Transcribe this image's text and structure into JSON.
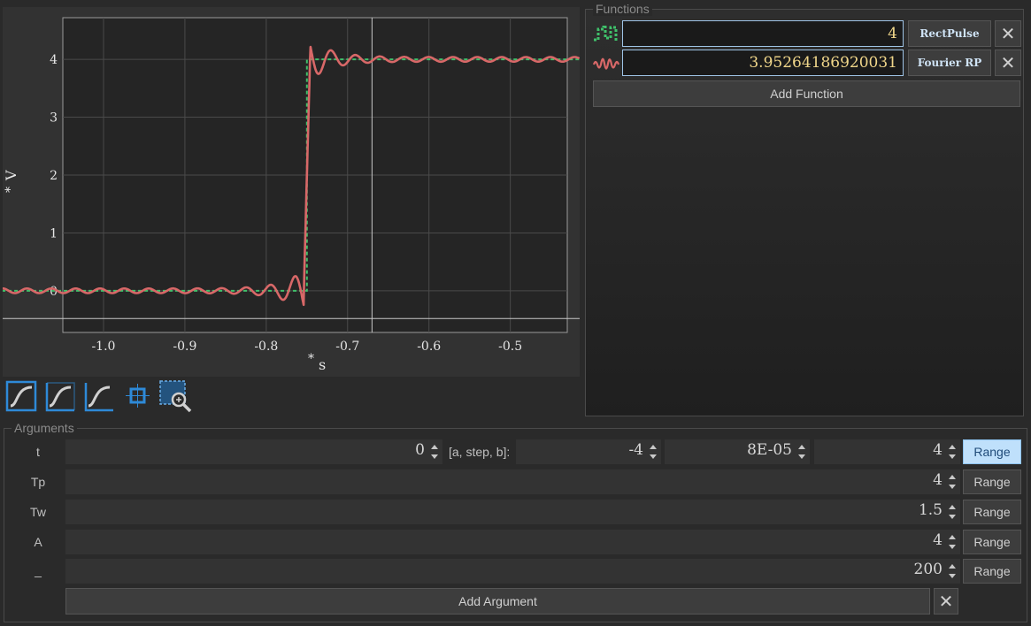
{
  "plot": {
    "x_unit": "s",
    "y_unit": "V",
    "unit_prefix": "*"
  },
  "chart_data": {
    "type": "line",
    "xlim": [
      -1.05,
      -0.43
    ],
    "ylim": [
      -0.72,
      4.72
    ],
    "x_ticks": [
      "-1.0",
      "-0.9",
      "-0.8",
      "-0.7",
      "-0.6",
      "-0.5"
    ],
    "x_tick_values": [
      -1.0,
      -0.9,
      -0.8,
      -0.7,
      -0.6,
      -0.5
    ],
    "y_ticks": [
      "0",
      "1",
      "2",
      "3",
      "4"
    ],
    "y_tick_values": [
      0,
      1,
      2,
      3,
      4
    ],
    "grid": true,
    "crosshair": {
      "x": -0.67,
      "y": -0.48
    },
    "series": [
      {
        "name": "RectPulse",
        "color": "#3fc06a",
        "style": "dashed",
        "edge_x": -0.75,
        "low": 0,
        "high": 4
      },
      {
        "name": "Fourier RP",
        "color": "#d86868",
        "style": "solid",
        "edge_x": -0.75,
        "low": 0,
        "high": 4,
        "overshoot_max": 4.38,
        "undershoot_min": -0.38
      }
    ]
  },
  "toolbar": {
    "buttons": [
      {
        "icon": "curve-fit-icon",
        "active": false
      },
      {
        "icon": "curve-fit-x-icon",
        "active": false
      },
      {
        "icon": "curve-fit-y-icon",
        "active": false
      },
      {
        "icon": "crosshair-icon",
        "active": false
      },
      {
        "icon": "zoom-region-icon",
        "active": true
      }
    ],
    "accent": "#2e8ad8"
  },
  "functions": {
    "title": "Functions",
    "items": [
      {
        "icon": "pulse-dashed-icon",
        "value": "4",
        "name": "RectPulse",
        "color": "#3fc06a"
      },
      {
        "icon": "wave-icon",
        "value": "3.95264186920031",
        "name": "Fourier RP",
        "color": "#d86868"
      }
    ],
    "close_symbol": "✕",
    "add_label": "Add Function"
  },
  "arguments": {
    "title": "Arguments",
    "step_label": "[a, step, b]:",
    "range_label": "Range",
    "items": [
      {
        "name": "t",
        "value": "0",
        "a": "-4",
        "step": "8E-05",
        "b": "4",
        "range_active": true
      },
      {
        "name": "Tp",
        "value": "4",
        "range_active": false
      },
      {
        "name": "Tw",
        "value": "1.5",
        "range_active": false
      },
      {
        "name": "A",
        "value": "4",
        "range_active": false
      },
      {
        "name": "_",
        "value": "200",
        "range_active": false
      }
    ],
    "add_label": "Add Argument",
    "close_symbol": "✕"
  }
}
